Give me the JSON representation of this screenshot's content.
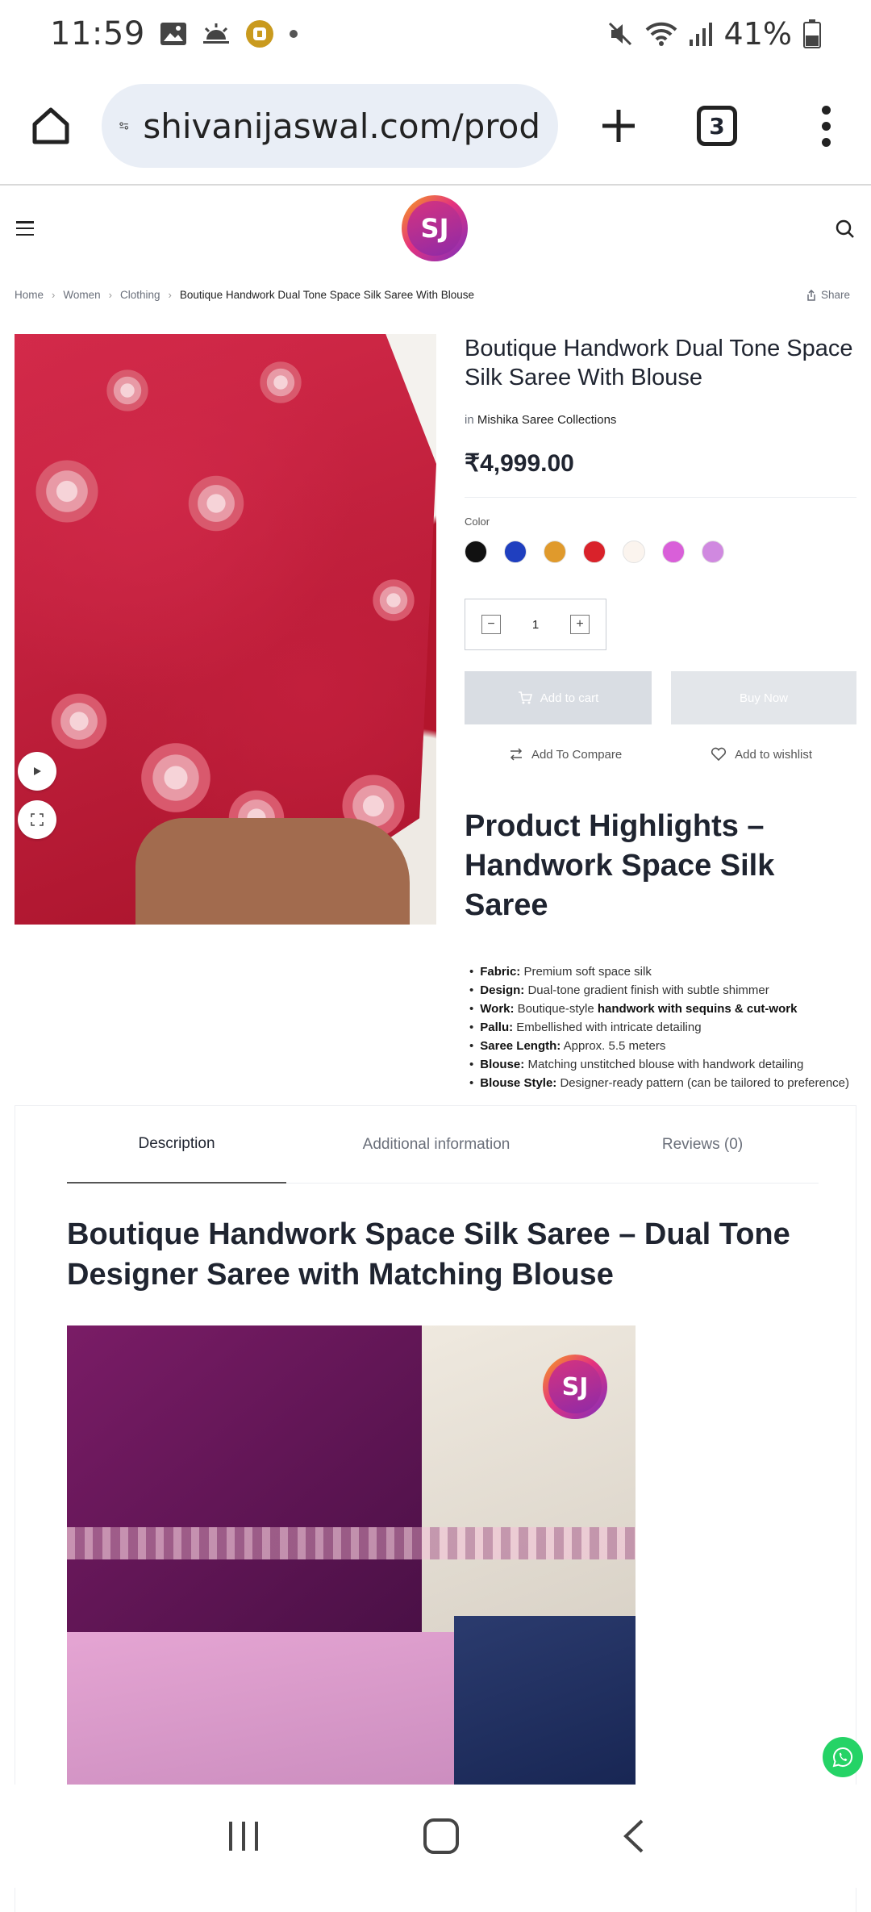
{
  "status_bar": {
    "time": "11:59",
    "battery": "41%"
  },
  "browser": {
    "url": "shivanijaswal.com/prod",
    "tab_count": "3"
  },
  "site": {
    "logo_text": "SJ"
  },
  "breadcrumb": {
    "home": "Home",
    "women": "Women",
    "clothing": "Clothing",
    "current": "Boutique Handwork Dual Tone Space Silk Saree With Blouse"
  },
  "share_label": "Share",
  "product": {
    "title": "Boutique Handwork Dual Tone Space Silk Saree With Blouse",
    "brand_prefix": "in",
    "brand": "Mishika Saree Collections",
    "price": "₹4,999.00",
    "color_label": "Color",
    "colors": [
      "#111111",
      "#1f3fbf",
      "#e09a2c",
      "#d9222a",
      "#fbf4ee",
      "#d95fd9",
      "#d089e0"
    ],
    "quantity": "1",
    "qty_minus": "−",
    "qty_plus": "+",
    "add_to_cart": "Add to cart",
    "buy_now": "Buy Now",
    "add_to_compare": "Add To Compare",
    "add_to_wishlist": "Add to wishlist"
  },
  "highlights": {
    "title": "Product Highlights – Handwork Space Silk Saree",
    "items": [
      {
        "label": "Fabric:",
        "text": " Premium soft space silk",
        "bold": "",
        "tail": ""
      },
      {
        "label": "Design:",
        "text": " Dual-tone gradient finish with subtle shimmer",
        "bold": "",
        "tail": ""
      },
      {
        "label": "Work:",
        "text": " Boutique-style ",
        "bold": "handwork with sequins & cut-work",
        "tail": ""
      },
      {
        "label": "Pallu:",
        "text": " Embellished with intricate detailing",
        "bold": "",
        "tail": ""
      },
      {
        "label": "Saree Length:",
        "text": " Approx. 5.5 meters",
        "bold": "",
        "tail": ""
      },
      {
        "label": "Blouse:",
        "text": " Matching unstitched blouse with handwork detailing",
        "bold": "",
        "tail": ""
      },
      {
        "label": "Blouse Style:",
        "text": " Designer-ready pattern (can be tailored to preference)",
        "bold": "",
        "tail": ""
      }
    ]
  },
  "tabs": {
    "description": "Description",
    "additional": "Additional information",
    "reviews": "Reviews (0)"
  },
  "description": {
    "title": "Boutique Handwork Space Silk Saree – Dual Tone Designer Saree with Matching Blouse",
    "image_logo": "SJ"
  }
}
